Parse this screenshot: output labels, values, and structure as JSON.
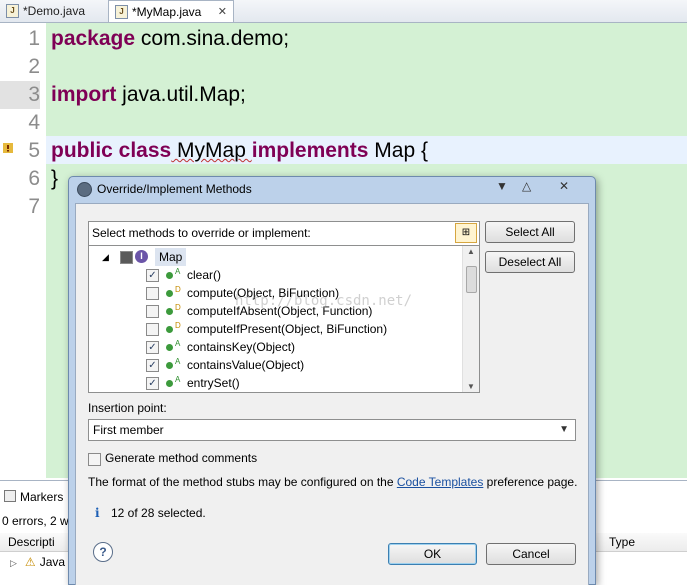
{
  "tabs": [
    {
      "label": "*Demo.java"
    },
    {
      "label": "*MyMap.java",
      "close": "✕"
    }
  ],
  "code": {
    "lines": [
      {
        "num": "1",
        "kw": "package",
        "rest": " com.sina.demo;"
      },
      {
        "num": "2"
      },
      {
        "num": "3",
        "kw": "import",
        "rest": " java.util.Map;"
      },
      {
        "num": "4"
      },
      {
        "num": "5",
        "kw": "public class",
        "cls": " MyMap ",
        "kw2": "implements",
        "rest": " Map {"
      },
      {
        "num": "6",
        "rest": "}"
      },
      {
        "num": "7"
      }
    ]
  },
  "markers": {
    "tab": "Markers",
    "summary": "0 errors, 2 w",
    "col_desc": "Descripti",
    "col_type": "Type",
    "row": "Java"
  },
  "dialog": {
    "title": "Override/Implement Methods",
    "select_label": "Select methods to override or implement:",
    "select_all": "Select All",
    "deselect_all": "Deselect All",
    "root": "Map",
    "methods": [
      {
        "label": "clear()",
        "checked": true,
        "tag": "A"
      },
      {
        "label": "compute(Object, BiFunction)",
        "checked": false,
        "tag": "D"
      },
      {
        "label": "computeIfAbsent(Object, Function)",
        "checked": false,
        "tag": "D"
      },
      {
        "label": "computeIfPresent(Object, BiFunction)",
        "checked": false,
        "tag": "D"
      },
      {
        "label": "containsKey(Object)",
        "checked": true,
        "tag": "A"
      },
      {
        "label": "containsValue(Object)",
        "checked": true,
        "tag": "A"
      },
      {
        "label": "entrySet()",
        "checked": true,
        "tag": "A"
      }
    ],
    "insertion_label": "Insertion point:",
    "insertion_value": "First member",
    "generate_comments": "Generate method comments",
    "format_pre": "The format of the method stubs may be configured on the ",
    "format_link": "Code Templates",
    "format_post": " preference page.",
    "status": "12 of 28 selected.",
    "ok": "OK",
    "cancel": "Cancel",
    "help": "?",
    "info": "i"
  },
  "watermark": "http://blog.csdn.net/"
}
